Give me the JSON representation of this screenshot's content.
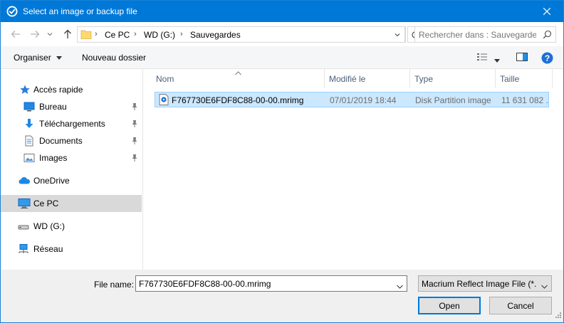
{
  "window": {
    "title": "Select an image or backup file",
    "accent": "#0078d7"
  },
  "address": {
    "breadcrumbs": [
      "Ce PC",
      "WD (G:)",
      "Sauvegardes"
    ],
    "search_placeholder": "Rechercher dans : Sauvegardes"
  },
  "toolbar": {
    "organize_label": "Organiser",
    "new_folder_label": "Nouveau dossier"
  },
  "sidebar": {
    "items": [
      {
        "label": "Accès rapide",
        "icon": "star-icon",
        "pinned": false
      },
      {
        "label": "Bureau",
        "icon": "desktop-icon",
        "pinned": true
      },
      {
        "label": "Téléchargements",
        "icon": "download-icon",
        "pinned": true
      },
      {
        "label": "Documents",
        "icon": "document-icon",
        "pinned": true
      },
      {
        "label": "Images",
        "icon": "image-icon",
        "pinned": true
      },
      {
        "label": "OneDrive",
        "icon": "cloud-icon",
        "pinned": false
      },
      {
        "label": "Ce PC",
        "icon": "computer-icon",
        "pinned": false,
        "selected": true
      },
      {
        "label": "WD (G:)",
        "icon": "drive-icon",
        "pinned": false
      },
      {
        "label": "Réseau",
        "icon": "network-icon",
        "pinned": false
      }
    ]
  },
  "files": {
    "columns": [
      "Nom",
      "Modifié le",
      "Type",
      "Taille"
    ],
    "rows": [
      {
        "name": "F767730E6FDF8C88-00-00.mrimg",
        "modified": "07/01/2019 18:44",
        "type": "Disk Partition image",
        "size": "11 631 082 ...",
        "selected": true
      }
    ]
  },
  "footer": {
    "filename_label": "File name:",
    "filename_value": "F767730E6FDF8C88-00-00.mrimg",
    "filetype_value": "Macrium Reflect Image File (*.mrimg)",
    "open_label": "Open",
    "cancel_label": "Cancel"
  }
}
